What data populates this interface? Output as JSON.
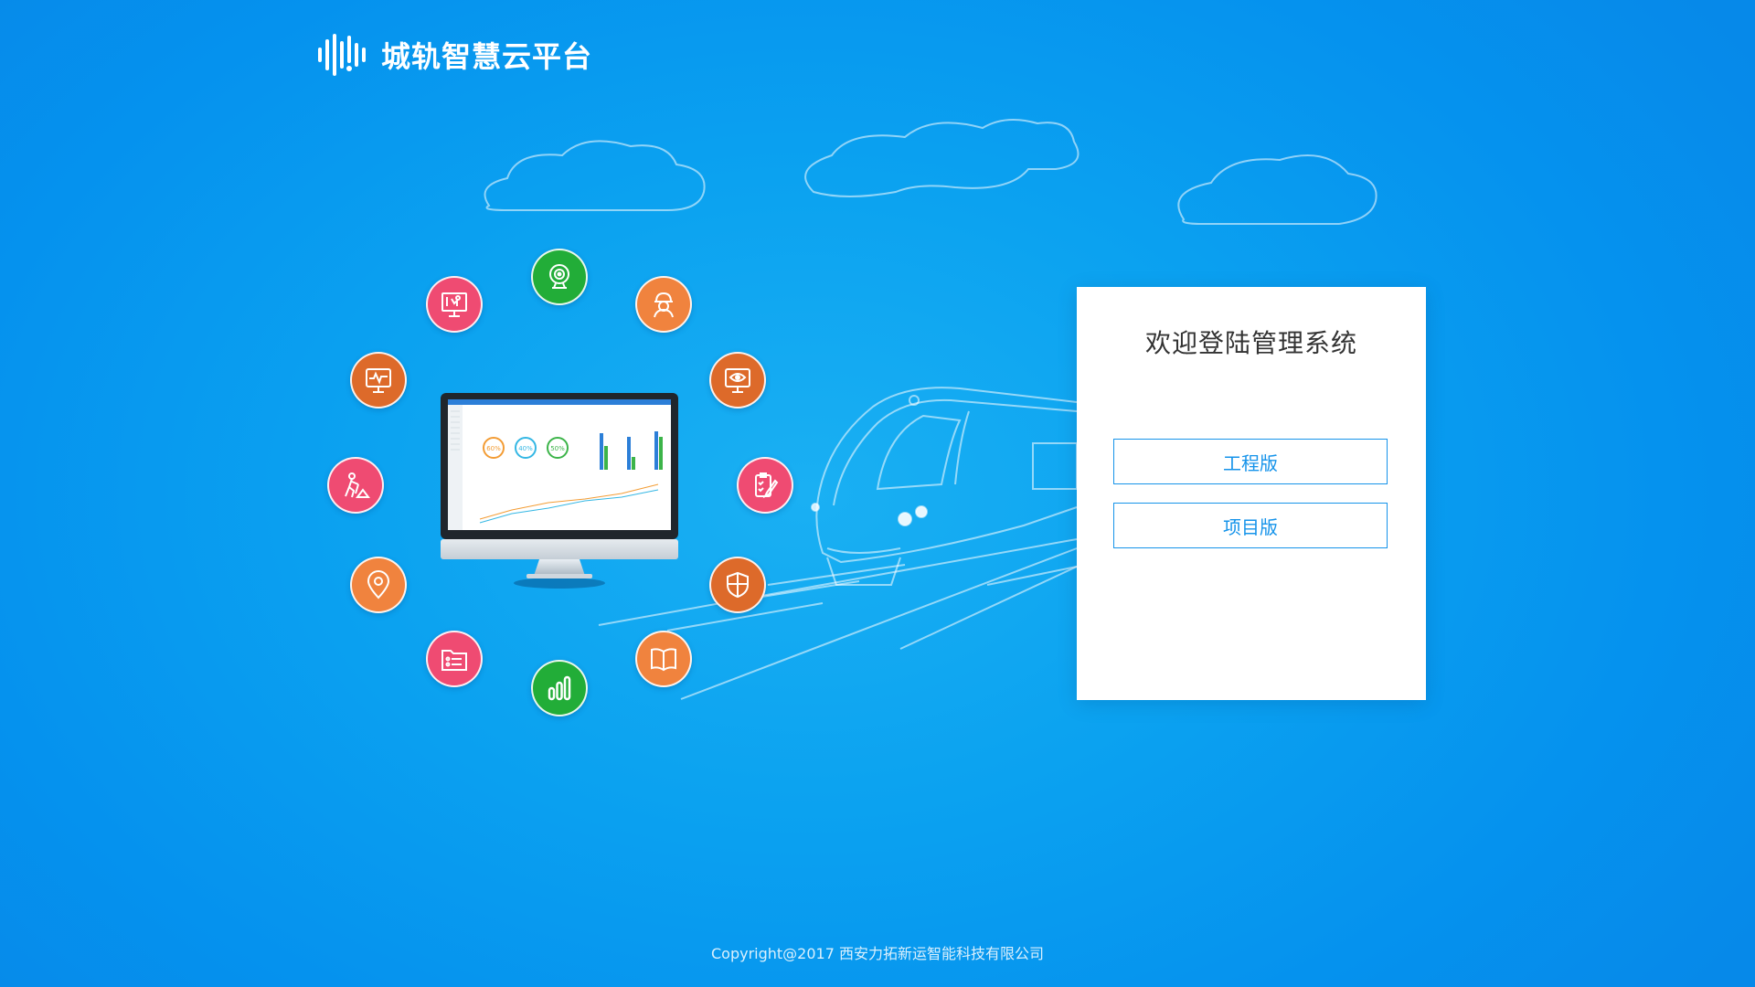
{
  "header": {
    "app_title": "城轨智慧云平台",
    "logo_icon": "sound-wave-logo-icon"
  },
  "login": {
    "welcome": "欢迎登陆管理系统",
    "engineering_label": "工程版",
    "project_label": "项目版"
  },
  "monitor_screen": {
    "gauges": [
      "60%",
      "40%",
      "50%"
    ]
  },
  "feature_icons": [
    {
      "name": "webcam-icon",
      "color": "#22ad38"
    },
    {
      "name": "construction-worker-icon",
      "color": "#f0833e"
    },
    {
      "name": "monitor-eye-icon",
      "color": "#dd6a2a"
    },
    {
      "name": "clipboard-edit-icon",
      "color": "#ef4b72"
    },
    {
      "name": "shield-icon",
      "color": "#dd6a2a"
    },
    {
      "name": "book-icon",
      "color": "#f0833e"
    },
    {
      "name": "bar-chart-icon",
      "color": "#22ad38"
    },
    {
      "name": "folder-list-icon",
      "color": "#ef4b72"
    },
    {
      "name": "map-pin-icon",
      "color": "#f0833e"
    },
    {
      "name": "worker-digging-icon",
      "color": "#ef4b72"
    },
    {
      "name": "monitor-pulse-icon",
      "color": "#dd6a2a"
    },
    {
      "name": "presentation-board-icon",
      "color": "#ef4b72"
    }
  ],
  "footer": {
    "copyright": "Copyright@2017 西安力拓新运智能科技有限公司"
  }
}
